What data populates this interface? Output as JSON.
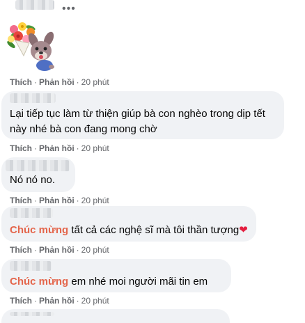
{
  "top": {
    "more_icon": "more-horiz-icon",
    "more_glyph": "•••"
  },
  "sticker": {
    "icon": "dog-with-flower-bouquet-sticker"
  },
  "action_labels": {
    "like": "Thích",
    "reply": "Phản hồi",
    "separator": "·"
  },
  "comments": [
    {
      "time": "20 phút"
    },
    {
      "line1": "Lại tiếp tục làm từ thiện giúp bà con nghèo trong dịp tết",
      "line2": "này nhé bà con đang mong chờ",
      "time": "20 phút"
    },
    {
      "text": "Nó nó no.",
      "time": "20 phút"
    },
    {
      "highlight": "Chúc mừng",
      "text": " tất cả các nghệ sĩ mà tôi thần tượng",
      "emoji": "❤",
      "time": "20 phút"
    },
    {
      "highlight": "Chúc mừng",
      "text": " em nhé moi người mãi tin em",
      "time": "20 phút"
    }
  ],
  "colors": {
    "bubble": "#f0f2f5",
    "highlight": "#e4664c",
    "meta": "#65676b",
    "heart": "#e41e3f"
  }
}
